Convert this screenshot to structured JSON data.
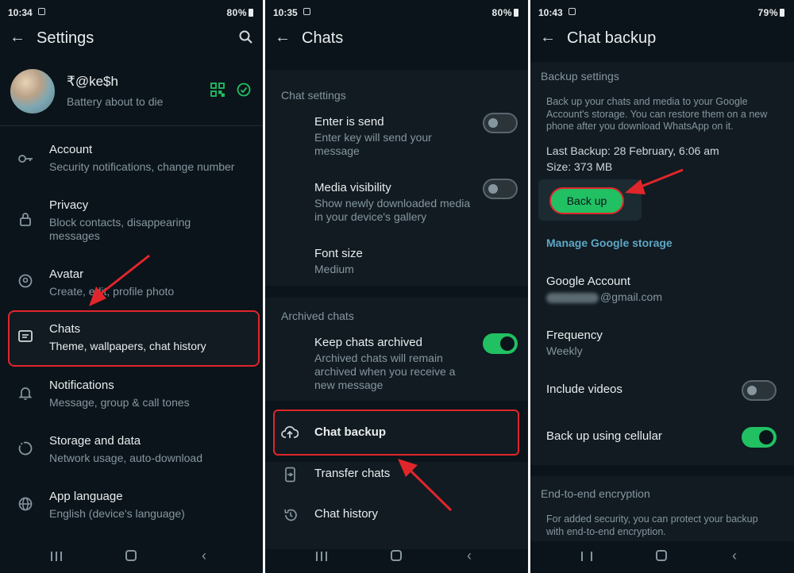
{
  "panel1": {
    "status": {
      "time": "10:34",
      "battery": "80%"
    },
    "appbar": {
      "title": "Settings"
    },
    "profile": {
      "name": "₹@ke$h",
      "status": "Battery about to die"
    },
    "items": [
      {
        "title": "Account",
        "subtitle": "Security notifications, change number",
        "icon": "key-icon"
      },
      {
        "title": "Privacy",
        "subtitle": "Block contacts, disappearing messages",
        "icon": "lock-icon"
      },
      {
        "title": "Avatar",
        "subtitle": "Create, edit, profile photo",
        "icon": "avatar-icon"
      },
      {
        "title": "Chats",
        "subtitle": "Theme, wallpapers, chat history",
        "icon": "chat-icon"
      },
      {
        "title": "Notifications",
        "subtitle": "Message, group & call tones",
        "icon": "bell-icon"
      },
      {
        "title": "Storage and data",
        "subtitle": "Network usage, auto-download",
        "icon": "storage-icon"
      },
      {
        "title": "App language",
        "subtitle": "English (device's language)",
        "icon": "globe-icon"
      }
    ]
  },
  "panel2": {
    "status": {
      "time": "10:35",
      "battery": "80%"
    },
    "appbar": {
      "title": "Chats"
    },
    "sections": {
      "chat_settings": "Chat settings",
      "archived_chats": "Archived chats"
    },
    "enter_is_send": {
      "title": "Enter is send",
      "subtitle": "Enter key will send your message",
      "enabled": false
    },
    "media_visibility": {
      "title": "Media visibility",
      "subtitle": "Show newly downloaded media in your device's gallery",
      "enabled": false
    },
    "font_size": {
      "title": "Font size",
      "value": "Medium"
    },
    "keep_archived": {
      "title": "Keep chats archived",
      "subtitle": "Archived chats will remain archived when you receive a new message",
      "enabled": true
    },
    "actions": [
      {
        "label": "Chat backup",
        "icon": "cloud-upload-icon"
      },
      {
        "label": "Transfer chats",
        "icon": "phone-transfer-icon"
      },
      {
        "label": "Chat history",
        "icon": "history-icon"
      }
    ]
  },
  "panel3": {
    "status": {
      "time": "10:43",
      "battery": "79%"
    },
    "appbar": {
      "title": "Chat backup"
    },
    "backup_settings_label": "Backup settings",
    "description": "Back up your chats and media to your Google Account's storage. You can restore them on a new phone after you download WhatsApp on it.",
    "last_backup": "Last Backup: 28 February, 6:06 am",
    "size": "Size: 373 MB",
    "backup_button": "Back up",
    "manage_link": "Manage Google storage",
    "google_account": {
      "title": "Google Account",
      "value": "@gmail.com"
    },
    "frequency": {
      "title": "Frequency",
      "value": "Weekly"
    },
    "include_videos": {
      "title": "Include videos",
      "enabled": false
    },
    "cellular": {
      "title": "Back up using cellular",
      "enabled": true
    },
    "e2e": {
      "title": "End-to-end encryption",
      "description": "For added security, you can protect your backup with end-to-end encryption."
    }
  },
  "colors": {
    "accent": "#21c063",
    "annotation": "#e0262b",
    "background": "#0b141a",
    "link": "#5fa7c6"
  }
}
